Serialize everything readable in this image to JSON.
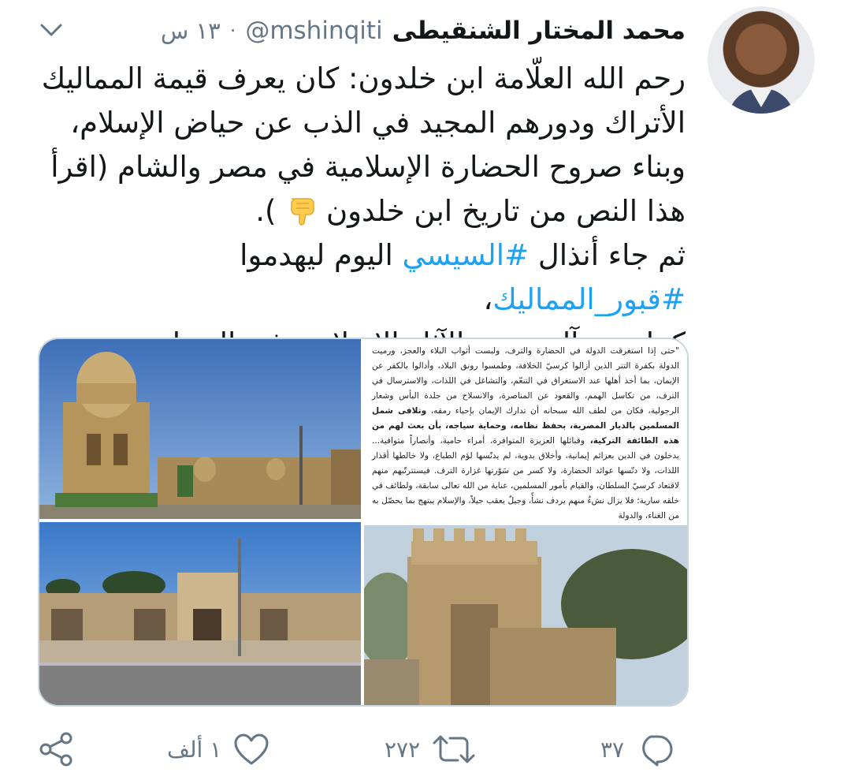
{
  "tweet": {
    "author_name": "محمد المختار الشنقيطى",
    "handle": "@mshinqiti",
    "separator": "·",
    "time": "١٣ س",
    "text": {
      "line1": "رحم الله العلّامة ابن خلدون: كان يعرف قيمة المماليك",
      "line2": "الأتراك ودورهم المجيد في الذب عن حياض الإسلام،",
      "line3": "وبناء صروح الحضارة الإسلامية في مصر والشام (اقرأ",
      "line4": "هذا النص من تاريخ ابن خلدون",
      "line4_end": ").",
      "line5_pre": "ثم جاء أنذال",
      "hashtag1": "#السيسي",
      "line5_mid": "اليوم ليهدموا",
      "hashtag2": "#قبور_المماليك",
      "line5_end": "،",
      "line6": "كما هدم آل سعود الآثار الإسلامية في الحجاز"
    },
    "emoji": "backhand-index-pointing-down",
    "media": {
      "document_text": {
        "p1": "\"حتى إذا استغرقت الدولة في الحضارة والترف، ولبست أثواب البلاء والعجز، ورميت الدولة بكفرة التتر الذين أزالوا كرسيّ الخلافة، وطمسوا رونق البلاد، وأدالوا بالكفر عن الإيمان، بما أخذ أهلها عند الاستغراق في التنعّم، والتشاغل في اللذات، والاسترسال في الترف، من تكاسل الهمم، والقعود عن المناصرة، والانسلاخ من جلدة البأس وشعار الرجولية، فكان من لطف الله سبحانه أن تدارك الإيمان بإحياء رمقه،",
        "p1_bold": "وتلافى شمل المسلمين بالديار المصرية، بحفظ نظامه، وحماية سياجه، بأن بعث لهم من هذه الطائفة التركية،",
        "p2": "وقبائلها العزيزة المتوافرة، أمراء حامية، وأنصاراً متوافية... يدخلون في الدين بعزائم إيمانية، وأخلاق بدوية، لم يدنّسها لؤم الطباع، ولا خالطها أقذار اللذات، ولا دنّسها عوائد الحضارة، ولا كسر من سَوْرتها غزارة الترف. فيستترتّبهم منهم لاقتعاد كرسيّ السلطان، والقيام بأمور المسلمين، عناية من الله تعالى سابقة، ولطائف في خلقه سارية؛ فلا يزال نشءٌ منهم يردف نشأً، وجيلٌ يعقب جيلاً، والإسلام يبتهج بما يحصّل به من الغناء، والدولة"
      }
    },
    "actions": {
      "reply_count": "٣٧",
      "retweet_count": "٢٧٢",
      "like_count": "١ ألف"
    }
  }
}
